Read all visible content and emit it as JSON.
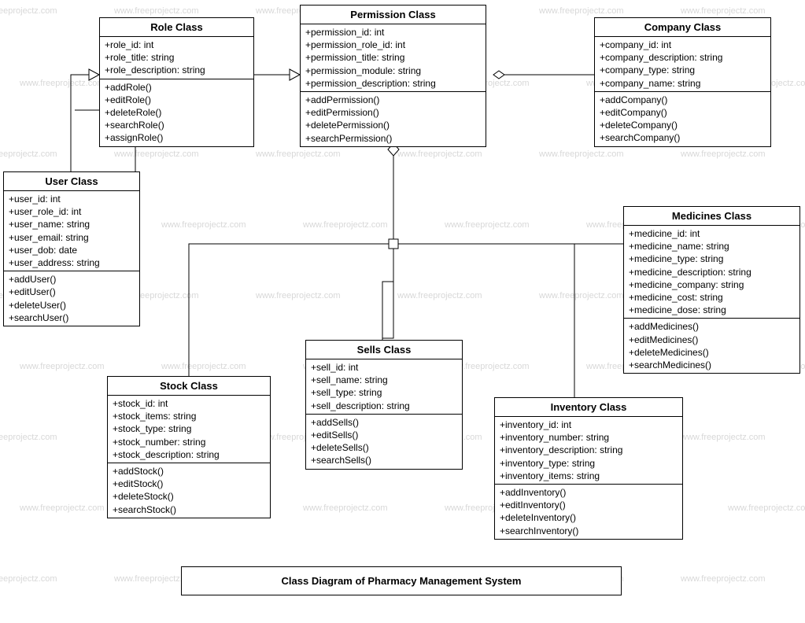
{
  "watermark_text": "www.freeprojectz.com",
  "caption": "Class Diagram of Pharmacy Management System",
  "classes": {
    "role": {
      "title": "Role Class",
      "attrs": [
        "+role_id: int",
        "+role_title: string",
        "+role_description: string"
      ],
      "ops": [
        "+addRole()",
        "+editRole()",
        "+deleteRole()",
        "+searchRole()",
        "+assignRole()"
      ]
    },
    "permission": {
      "title": "Permission Class",
      "attrs": [
        "+permission_id: int",
        "+permission_role_id: int",
        "+permission_title: string",
        "+permission_module: string",
        "+permission_description: string"
      ],
      "ops": [
        "+addPermission()",
        "+editPermission()",
        "+deletePermission()",
        "+searchPermission()"
      ]
    },
    "company": {
      "title": "Company Class",
      "attrs": [
        "+company_id: int",
        "+company_description: string",
        "+company_type: string",
        "+company_name: string"
      ],
      "ops": [
        "+addCompany()",
        "+editCompany()",
        "+deleteCompany()",
        "+searchCompany()"
      ]
    },
    "user": {
      "title": "User Class",
      "attrs": [
        "+user_id: int",
        "+user_role_id: int",
        "+user_name: string",
        "+user_email: string",
        "+user_dob: date",
        "+user_address: string"
      ],
      "ops": [
        "+addUser()",
        "+editUser()",
        "+deleteUser()",
        "+searchUser()"
      ]
    },
    "medicines": {
      "title": "Medicines Class",
      "attrs": [
        "+medicine_id: int",
        "+medicine_name: string",
        "+medicine_type: string",
        "+medicine_description: string",
        "+medicine_company: string",
        "+medicine_cost: string",
        "+medicine_dose: string"
      ],
      "ops": [
        "+addMedicines()",
        "+editMedicines()",
        "+deleteMedicines()",
        "+searchMedicines()"
      ]
    },
    "sells": {
      "title": "Sells Class",
      "attrs": [
        "+sell_id: int",
        "+sell_name: string",
        "+sell_type: string",
        "+sell_description: string"
      ],
      "ops": [
        "+addSells()",
        "+editSells()",
        "+deleteSells()",
        "+searchSells()"
      ]
    },
    "stock": {
      "title": "Stock Class",
      "attrs": [
        "+stock_id: int",
        "+stock_items: string",
        "+stock_type: string",
        "+stock_number: string",
        "+stock_description: string"
      ],
      "ops": [
        "+addStock()",
        "+editStock()",
        "+deleteStock()",
        "+searchStock()"
      ]
    },
    "inventory": {
      "title": "Inventory Class",
      "attrs": [
        "+inventory_id: int",
        "+inventory_number: string",
        "+inventory_description: string",
        "+inventory_type: string",
        "+inventory_items: string"
      ],
      "ops": [
        "+addInventory()",
        "+editInventory()",
        "+deleteInventory()",
        "+searchInventory()"
      ]
    }
  }
}
